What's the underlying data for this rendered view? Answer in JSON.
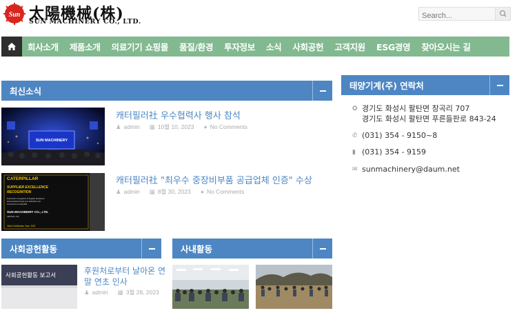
{
  "header": {
    "logo_cn": "太陽機械(株)",
    "logo_en": "SUN MACHINERY CO., LTD.",
    "logo_mark_text": "Sun",
    "search_placeholder": "Search..."
  },
  "nav": {
    "items": [
      "회사소개",
      "제품소개",
      "의료기기 쇼핑몰",
      "품질/환경",
      "투자정보",
      "소식",
      "사회공헌",
      "고객지원",
      "ESG경영",
      "찾아오시는 길"
    ]
  },
  "latest_news": {
    "title": "최신소식",
    "posts": [
      {
        "title": "캐터필러社 우수협력사 행사 참석",
        "author": "admin",
        "date": "10월 10, 2023",
        "comments": "No Comments",
        "image_label": "SUN MACHINERY"
      },
      {
        "title": "캐터필러社 \"최우수 중장비부품 공급업체 인증\" 수상",
        "author": "admin",
        "date": "8월 30, 2023",
        "comments": "No Comments",
        "image_lines": [
          "CATERPILLAR",
          "SUPPLIER EXCELLENCE",
          "RECOGNITION",
          "Presented in recognition of Supplier Excellence",
          "demonstrated through your dedication and",
          "commitment to Caterpillar",
          "SUN MACHINERY CO., LTD.",
          "JEONJU, KR",
          "Initial Certification Year: 2023"
        ]
      }
    ]
  },
  "social": {
    "title": "사회공헌활동",
    "post": {
      "image_label": "사회공헌활동 보고서",
      "title_line1": "후원처로부터 날아온 연",
      "title_line2": "말 연초 인사",
      "author": "admin",
      "date": "3월 28, 2023"
    }
  },
  "internal": {
    "title": "사내활동"
  },
  "contact": {
    "title": "태양기계(주) 연락처",
    "address_line1": "경기도 화성시 팔탄면 창곡리 707",
    "address_line2": "경기도 화성시 팔탄면 푸른들판로 843-24",
    "phone": "(031) 354 - 9150~8",
    "fax": "(031) 354 - 9159",
    "email": "sunmachinery@daum.net"
  },
  "colors": {
    "nav_bg": "#82b990",
    "section_header": "#4d86c3",
    "link": "#4d86c3",
    "logo_red": "#d7261e"
  },
  "icons": {
    "home": "home-icon",
    "search": "search-icon",
    "author": "user-icon",
    "date": "calendar-icon",
    "comments": "comment-icon",
    "address": "location-icon",
    "phone": "phone-icon",
    "fax": "fax-icon",
    "email": "envelope-icon"
  }
}
